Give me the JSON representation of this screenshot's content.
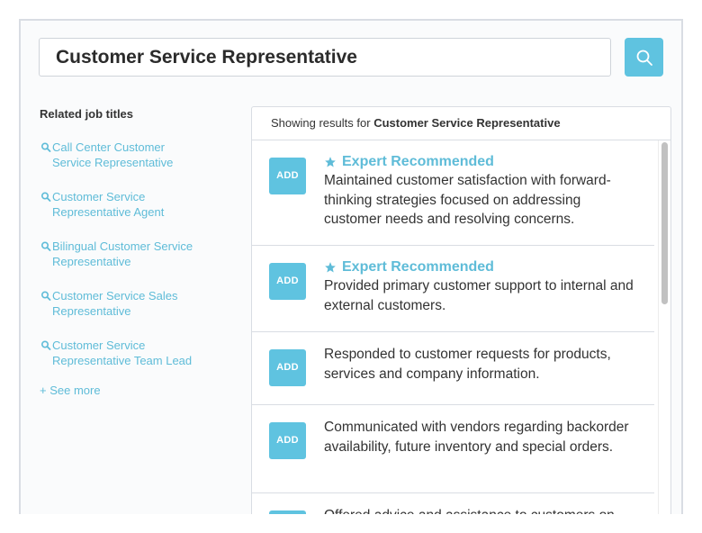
{
  "search": {
    "value": "Customer Service Representative",
    "button_icon": "search-icon"
  },
  "related": {
    "title": "Related job titles",
    "items": [
      {
        "label": "Call Center Customer Service Representative",
        "line1": "Call Center Customer",
        "line2": "Service Representative"
      },
      {
        "label": "Customer Service Representative Agent",
        "line1": "Customer Service",
        "line2": "Representative Agent"
      },
      {
        "label": "Bilingual Customer Service Representative",
        "line1": "Bilingual Customer Service",
        "line2": "Representative"
      },
      {
        "label": "Customer Service Sales Representative",
        "line1": "Customer Service Sales",
        "line2": "Representative"
      },
      {
        "label": "Customer Service Representative Team Lead",
        "line1": "Customer Service",
        "line2": "Representative Team Lead"
      }
    ],
    "see_more": "+ See more"
  },
  "results": {
    "header_prefix": "Showing results for",
    "header_query": "Customer Service Representative",
    "add_label": "ADD",
    "expert_label": "Expert Recommended",
    "items": [
      {
        "expert": true,
        "text": "Maintained customer satisfaction with forward-thinking strategies focused on addressing customer needs and resolving concerns."
      },
      {
        "expert": true,
        "text": "Provided primary customer support to internal and external customers."
      },
      {
        "expert": false,
        "text": "Responded to customer requests for products, services and company information."
      },
      {
        "expert": false,
        "text": "Communicated with vendors regarding backorder availability, future inventory and special orders."
      },
      {
        "expert": false,
        "text": "Offered advice and assistance to customers on"
      }
    ]
  },
  "colors": {
    "accent": "#5fc3e0",
    "link": "#5fbcd8",
    "border": "#d9dde3"
  }
}
